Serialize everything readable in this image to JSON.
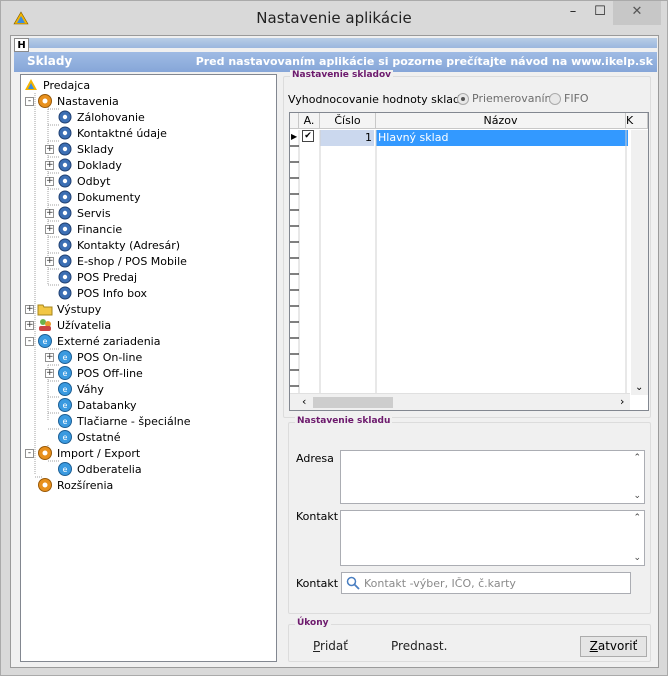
{
  "window": {
    "title": "Nastavenie aplikácie",
    "min_glyph": "–",
    "max_glyph": "☐",
    "close_glyph": "✕"
  },
  "ribbon": {
    "tab_label": "H"
  },
  "header": {
    "title": "Sklady",
    "note": "Pred nastavovaním aplikácie si pozorne prečítajte návod na www.ikelp.sk"
  },
  "tree": [
    {
      "label": "Predajca"
    },
    {
      "label": "Nastavenia"
    },
    {
      "label": "Zálohovanie"
    },
    {
      "label": "Kontaktné údaje"
    },
    {
      "label": "Sklady"
    },
    {
      "label": "Doklady"
    },
    {
      "label": "Odbyt"
    },
    {
      "label": "Dokumenty"
    },
    {
      "label": "Servis"
    },
    {
      "label": "Financie"
    },
    {
      "label": "Kontakty (Adresár)"
    },
    {
      "label": "E-shop / POS Mobile"
    },
    {
      "label": "POS Predaj"
    },
    {
      "label": "POS Info box"
    },
    {
      "label": "Výstupy"
    },
    {
      "label": "Užívatelia"
    },
    {
      "label": "Externé zariadenia"
    },
    {
      "label": "POS On-line"
    },
    {
      "label": "POS Off-line"
    },
    {
      "label": "Váhy"
    },
    {
      "label": "Databanky"
    },
    {
      "label": "Tlačiarne - špeciálne"
    },
    {
      "label": "Ostatné"
    },
    {
      "label": "Import / Export"
    },
    {
      "label": "Odberatelia"
    },
    {
      "label": "Rozšírenia"
    }
  ],
  "warehouse_settings": {
    "group_title": "Nastavenie skladov",
    "valuation_label": "Vyhodnocovanie hodnoty skladu",
    "option_average": "Priemerovaním",
    "option_fifo": "FIFO",
    "grid": {
      "columns": [
        "A.",
        "Číslo",
        "Názov",
        "K"
      ],
      "rows": [
        {
          "active": "✔",
          "number": "1",
          "name": "Hlavný sklad"
        }
      ],
      "row_indicator": "▶"
    }
  },
  "warehouse_detail": {
    "group_title": "Nastavenie skladu",
    "address_label": "Adresa",
    "contact_label_1": "Kontakt",
    "contact_label_2": "Kontakt",
    "contact_placeholder": "Kontakt -výber, IČO, č.karty"
  },
  "actions": {
    "group_title": "Úkony",
    "add_label": "Pridať",
    "preferred_label": "Prednast.",
    "close_label": "Zatvoriť"
  },
  "colors": {
    "header_bar": "#8eaedd",
    "selection": "#3399ff",
    "group_title": "#6d1a6d"
  }
}
